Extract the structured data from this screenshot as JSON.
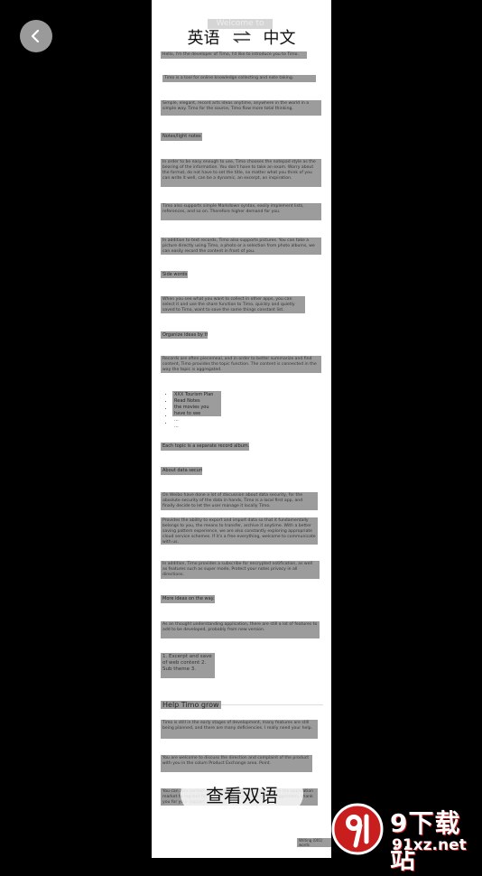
{
  "header": {
    "source_language": "英语",
    "target_language": "中文",
    "back_icon": "chevron-left-icon",
    "swap_icon": "swap-arrows-icon"
  },
  "document": {
    "welcome": "Welcome to you",
    "blocks": [
      "Hello, I'm the developer of Timo, I'd like to introduce you to Timo.",
      "Timo is a tool for online knowledge collecting and note taking.",
      "Simple, elegant, record arts ideas anytime, anywhere in the world in a simple way. Timo for the source, Timo flow more total thinking.",
      "Notes/light notes",
      "In order to be easy enough to use, Timo chooses the notepad style as the bearing of the information. You don't have to take an exam. Worry about the format, do not have to set the title, no matter what you think of you can write it well, can be a dynamic, an excerpt, an inspiration.",
      "Timo also supports simple Markdown syntax, easily implement lists, references, and so on. Therefore higher demand for you.",
      "In addition to text records, Timo also supports pictures. You can take a picture directly using Timo, a photo or a selection from photo albums, we can easily record the content in front of you.",
      "Side words so",
      "When you see what you want to collect in other apps, you can select it and use the share function to Timo, quickly and quietly saved to Timo, want to save the same things constant list.",
      "Organize ideas by theme",
      "Records are often piecemeal, and in order to better summarize and find content, Timo provides the topic function. The content is connected in the way the topic is aggregated.",
      "Each topic is a separate record album.",
      "About data security",
      "On Weibo have done a lot of discussion about data security, for the absolute security of the data in hands, Timo is a local first app, and finally decide to let the user manage it locally Timo.",
      "Provides the ability to export and import data so that it fundamentally belongs to you, the means to transfer, archive it anytime. With a better saving pattern experience, we are also constantly exploring appropriate cloud service schemes. If it's a free everything, welcome to communicate with us.",
      "In addition, Timo provides a subscribe for encrypted notification, as well as features such as super mode, Protect your notes privacy in all directions.",
      "More ideas on the way...",
      "As an thought understanding application, there are still a lot of features to add to be developed, probably from new version.",
      "1. Excerpt and save of web content 2. Sub theme 3.",
      "Timo is still in the early stages of development, many features are still being planned, and there are many deficiencies. I really need your help.",
      "You are welcome to discuss the direction and complaint of the product with you in the colum Product Exchange area. Point.",
      "You can also contact us by email or search for this app in the application market to register for feedback on your opinions and suggestions, thank you for your support of Timo."
    ],
    "bullets": [
      "XXX Tourism Plan",
      "Read Notes",
      "the movies you have to see",
      "...",
      "..."
    ],
    "help_heading": "Help Timo grow",
    "footer": "Writing (001) words"
  },
  "cta": {
    "label": "查看双语"
  },
  "watermark": {
    "brand": "9下载站",
    "url": "91xz.net",
    "logo_icon": "91xz-logo-icon"
  }
}
